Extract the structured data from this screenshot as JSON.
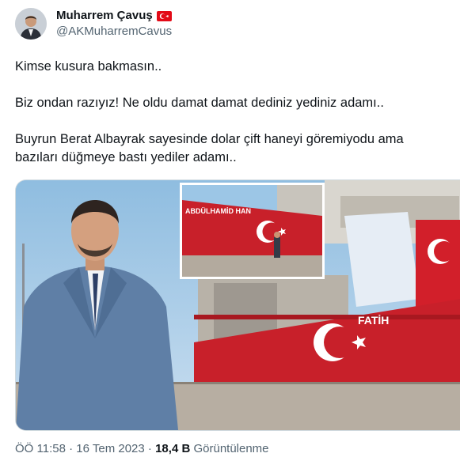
{
  "author": {
    "display_name": "Muharrem Çavuş",
    "handle": "@AKMuharremCavus",
    "flag_icon": "turkey-flag-icon"
  },
  "tweet": {
    "line1": "Kimse kusura bakmasın..",
    "line2": "Biz ondan razıyız! Ne oldu damat damat dediniz yediniz adamı..",
    "line3": "Buyrun Berat Albayrak sayesinde dolar çift haneyi göremiyodu ama bazıları düğmeye bastı yediler adamı.."
  },
  "media": {
    "inset_ship_name": "ABDÜLHAMİD HAN",
    "main_ship_name": "FATİH"
  },
  "meta": {
    "time": "ÖÖ 11:58",
    "separator1": "·",
    "date": "16 Tem 2023",
    "separator2": "·",
    "views_count": "18,4 B",
    "views_label": "Görüntülenme"
  },
  "colors": {
    "text": "#0f1419",
    "secondary": "#536471",
    "border": "#cfd9de",
    "flag_red": "#e30a17",
    "hull_red": "#c8202a"
  }
}
